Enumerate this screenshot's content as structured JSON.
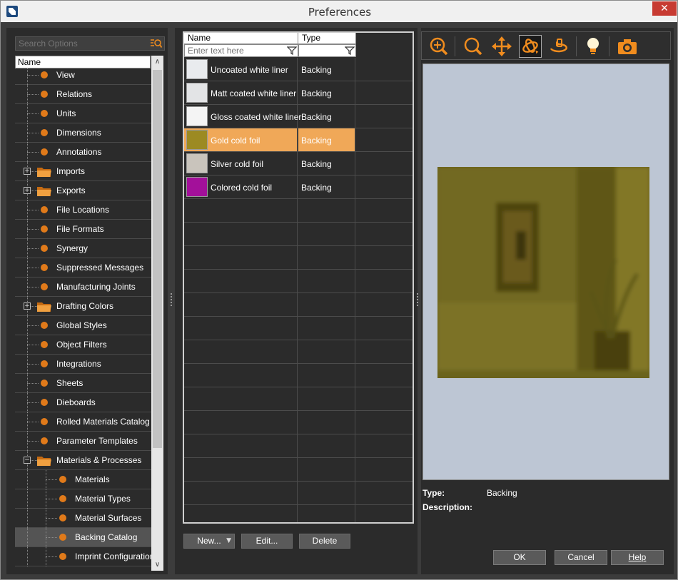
{
  "window": {
    "title": "Preferences",
    "close_glyph": "✕"
  },
  "search": {
    "placeholder": "Search Options"
  },
  "tree": {
    "header": "Name",
    "items": [
      {
        "label": "View",
        "kind": "leaf",
        "level": 1
      },
      {
        "label": "Relations",
        "kind": "leaf",
        "level": 1
      },
      {
        "label": "Units",
        "kind": "leaf",
        "level": 1
      },
      {
        "label": "Dimensions",
        "kind": "leaf",
        "level": 1
      },
      {
        "label": "Annotations",
        "kind": "leaf",
        "level": 1
      },
      {
        "label": "Imports",
        "kind": "folder",
        "level": 1,
        "expander": "+"
      },
      {
        "label": "Exports",
        "kind": "folder",
        "level": 1,
        "expander": "+"
      },
      {
        "label": "File Locations",
        "kind": "leaf",
        "level": 1
      },
      {
        "label": "File Formats",
        "kind": "leaf",
        "level": 1
      },
      {
        "label": "Synergy",
        "kind": "leaf",
        "level": 1
      },
      {
        "label": "Suppressed Messages",
        "kind": "leaf",
        "level": 1
      },
      {
        "label": "Manufacturing Joints",
        "kind": "leaf",
        "level": 1
      },
      {
        "label": "Drafting Colors",
        "kind": "folder",
        "level": 1,
        "expander": "+"
      },
      {
        "label": "Global Styles",
        "kind": "leaf",
        "level": 1
      },
      {
        "label": "Object Filters",
        "kind": "leaf",
        "level": 1
      },
      {
        "label": "Integrations",
        "kind": "leaf",
        "level": 1
      },
      {
        "label": "Sheets",
        "kind": "leaf",
        "level": 1
      },
      {
        "label": "Dieboards",
        "kind": "leaf",
        "level": 1
      },
      {
        "label": "Rolled Materials Catalog",
        "kind": "leaf",
        "level": 1
      },
      {
        "label": "Parameter Templates",
        "kind": "leaf",
        "level": 1
      },
      {
        "label": "Materials & Processes",
        "kind": "folder",
        "level": 1,
        "expander": "−"
      },
      {
        "label": "Materials",
        "kind": "leaf",
        "level": 2
      },
      {
        "label": "Material Types",
        "kind": "leaf",
        "level": 2
      },
      {
        "label": "Material Surfaces",
        "kind": "leaf",
        "level": 2
      },
      {
        "label": "Backing Catalog",
        "kind": "leaf",
        "level": 2,
        "selected": true
      },
      {
        "label": "Imprint Configurations",
        "kind": "leaf",
        "level": 2
      }
    ]
  },
  "grid": {
    "columns": [
      "Name",
      "Type"
    ],
    "filter_placeholder": "Enter text here",
    "rows": [
      {
        "name": "Uncoated white liner",
        "type": "Backing",
        "swatch": "#e9ebee"
      },
      {
        "name": "Matt coated white liner",
        "type": "Backing",
        "swatch": "#e3e4e6"
      },
      {
        "name": "Gloss coated white liner",
        "type": "Backing",
        "swatch": "#f4f4f4"
      },
      {
        "name": "Gold cold foil",
        "type": "Backing",
        "swatch": "#9c8a22",
        "selected": true
      },
      {
        "name": "Silver cold foil",
        "type": "Backing",
        "swatch": "#c9c4bc"
      },
      {
        "name": "Colored cold foil",
        "type": "Backing",
        "swatch": "#a3109a"
      }
    ],
    "empty_rows": 14
  },
  "grid_buttons": {
    "new": "New...",
    "edit": "Edit...",
    "delete": "Delete"
  },
  "toolbar": {
    "tools": [
      "zoom-in-icon",
      "zoom-icon",
      "pan-icon",
      "orbit-icon",
      "rotate-icon",
      "light-icon",
      "camera-icon"
    ],
    "active": "orbit-icon",
    "accent": "#f08c1e"
  },
  "details": {
    "type_label": "Type:",
    "type_value": "Backing",
    "description_label": "Description:"
  },
  "dialog_buttons": {
    "ok": "OK",
    "cancel": "Cancel",
    "help": "Help"
  }
}
